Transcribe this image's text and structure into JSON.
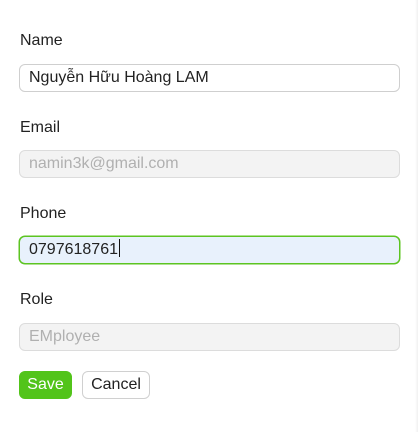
{
  "form": {
    "name": {
      "label": "Name",
      "value": "Nguyễn Hữu Hoàng LAM"
    },
    "email": {
      "label": "Email",
      "value": "namin3k@gmail.com",
      "disabled": true
    },
    "phone": {
      "label": "Phone",
      "value": "0797618761",
      "focused": true
    },
    "role": {
      "label": "Role",
      "value": "EMployee",
      "disabled": true
    }
  },
  "actions": {
    "save_label": "Save",
    "cancel_label": "Cancel"
  },
  "colors": {
    "primary": "#52c41a",
    "focus_bg": "#e8f1fc",
    "disabled_bg": "#f3f3f3",
    "disabled_text": "#b0b0b0"
  }
}
